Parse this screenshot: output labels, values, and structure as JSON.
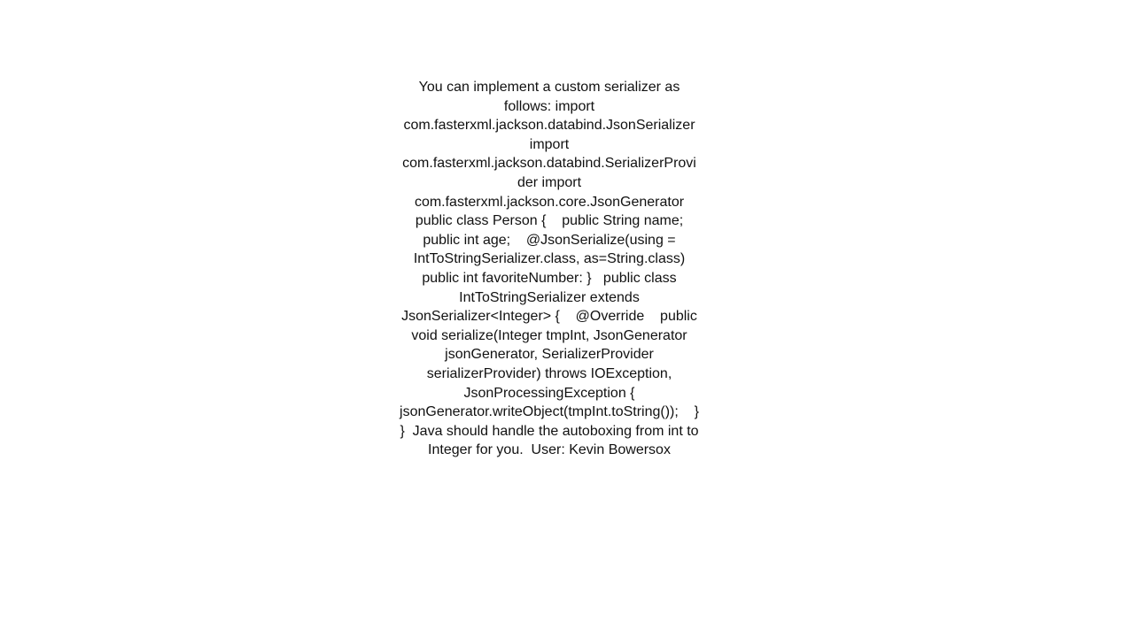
{
  "page": {
    "background_color": "#ffffff",
    "text_color": "#111111"
  },
  "answer": {
    "body": "You can implement a custom serializer as follows: import com.fasterxml.jackson.databind.JsonSerializer import com.fasterxml.jackson.databind.SerializerProvider import com.fasterxml.jackson.core.JsonGenerator   public class Person {    public String name;    public int age;    @JsonSerialize(using = IntToStringSerializer.class, as=String.class)    public int favoriteNumber: }   public class IntToStringSerializer extends JsonSerializer<Integer> {    @Override    public void serialize(Integer tmpInt, JsonGenerator jsonGenerator, SerializerProvider serializerProvider) throws IOException, JsonProcessingException {       jsonGenerator.writeObject(tmpInt.toString());    } }  Java should handle the autoboxing from int to Integer for you.  User: Kevin Bowersox"
  }
}
